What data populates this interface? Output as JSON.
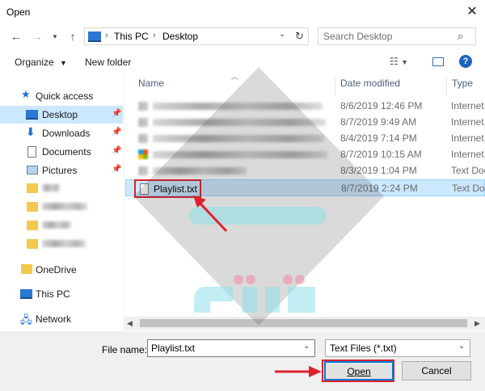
{
  "window": {
    "title": "Open"
  },
  "address": {
    "segments": [
      "This PC",
      "Desktop"
    ],
    "search_placeholder": "Search Desktop"
  },
  "toolbar": {
    "organize": "Organize",
    "new_folder": "New folder"
  },
  "sidebar": {
    "quick_access": "Quick access",
    "items": [
      {
        "label": "Desktop"
      },
      {
        "label": "Downloads"
      },
      {
        "label": "Documents"
      },
      {
        "label": "Pictures"
      }
    ],
    "onedrive": "OneDrive",
    "this_pc": "This PC",
    "network": "Network"
  },
  "columns": {
    "name": "Name",
    "date": "Date modified",
    "type": "Type"
  },
  "files": [
    {
      "name": "",
      "date": "8/6/2019 12:46 PM",
      "type": "Internet"
    },
    {
      "name": "",
      "date": "8/7/2019 9:49 AM",
      "type": "Internet"
    },
    {
      "name": "",
      "date": "8/4/2019 7:14 PM",
      "type": "Internet"
    },
    {
      "name": "",
      "date": "8/7/2019 10:15 AM",
      "type": "Internet"
    },
    {
      "name": "",
      "date": "8/3/2019 1:04 PM",
      "type": "Text Doc"
    },
    {
      "name": "Playlist.txt",
      "date": "8/7/2019 2:24 PM",
      "type": "Text Doc"
    }
  ],
  "footer": {
    "file_name_label": "File name:",
    "file_name_value": "Playlist.txt",
    "file_type": "Text Files (*.txt)",
    "open_button": "Open",
    "cancel_button": "Cancel"
  },
  "colors": {
    "highlight": "#e0212b",
    "selection": "#cce8ff",
    "sidebar_selected": "#cce8ff"
  }
}
